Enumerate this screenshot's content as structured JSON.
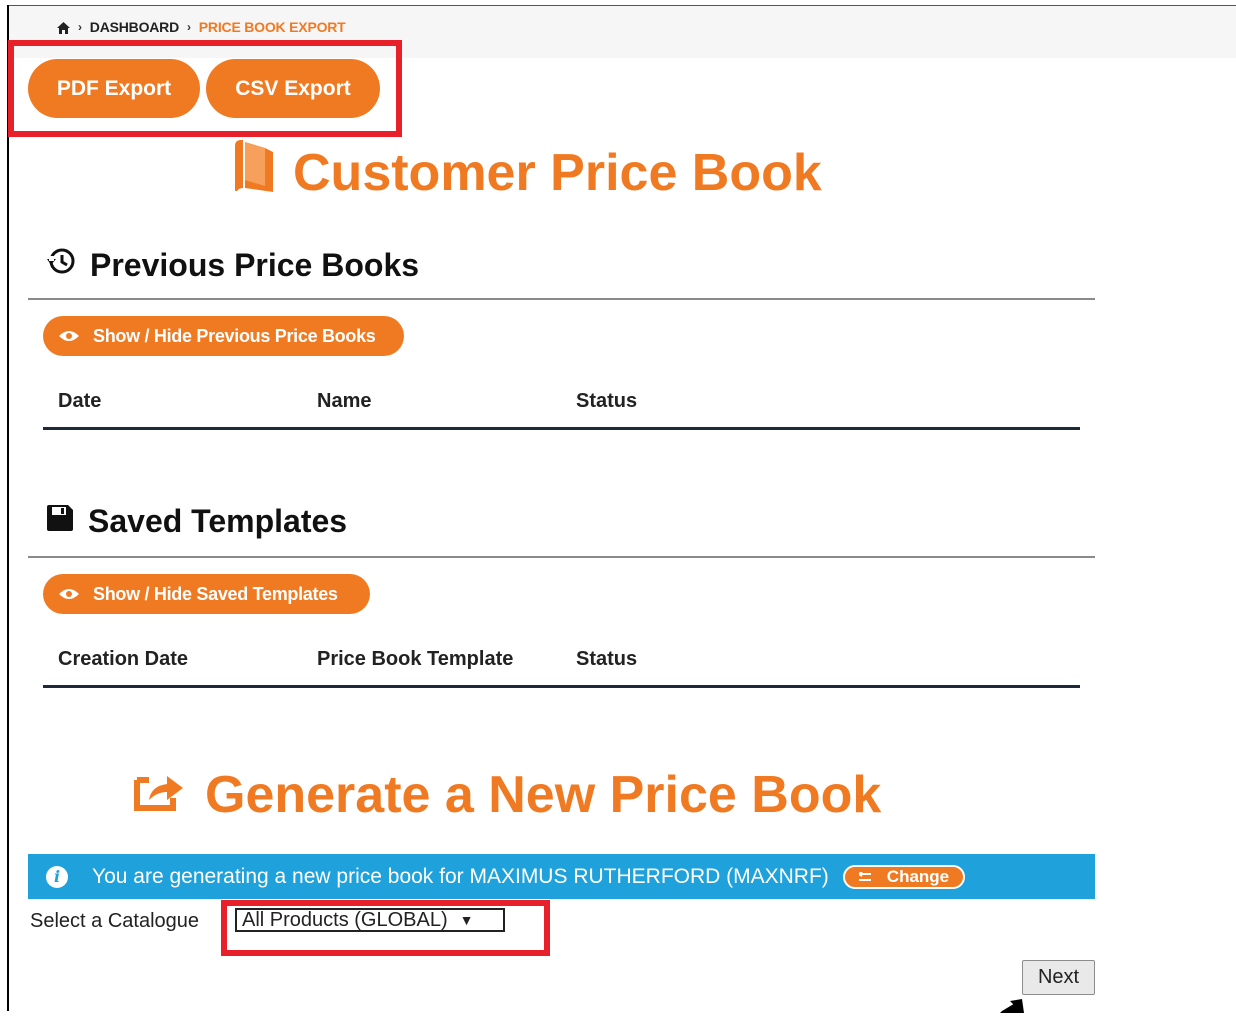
{
  "breadcrumb": {
    "home_icon": "home-icon",
    "items": [
      "DASHBOARD",
      "PRICE BOOK EXPORT"
    ]
  },
  "toolbar": {
    "pdf_label": "PDF Export",
    "csv_label": "CSV Export"
  },
  "header": {
    "title": "Customer Price Book",
    "icon": "book-icon"
  },
  "previous": {
    "title": "Previous Price Books",
    "icon": "history-icon",
    "toggle_label": "Show / Hide Previous Price Books",
    "toggle_icon": "eye-icon",
    "columns": [
      "Date",
      "Name",
      "Status"
    ]
  },
  "templates": {
    "title": "Saved Templates",
    "icon": "floppy-disk-icon",
    "toggle_label": "Show / Hide Saved Templates",
    "toggle_icon": "eye-icon",
    "columns": [
      "Creation Date",
      "Price Book Template",
      "Status"
    ]
  },
  "generate": {
    "title": "Generate a New Price Book",
    "icon": "share-export-icon",
    "info_text": "You are generating a new price book for MAXIMUS RUTHERFORD (MAXNRF)",
    "info_icon": "info-icon",
    "change_label": "Change",
    "change_icon": "swap-icon",
    "select_label": "Select a Catalogue",
    "catalogue_value": "All Products (GLOBAL)",
    "next_label": "Next"
  },
  "colors": {
    "accent": "#f07a22",
    "info": "#1fa1dc",
    "highlight": "#e8202a"
  }
}
